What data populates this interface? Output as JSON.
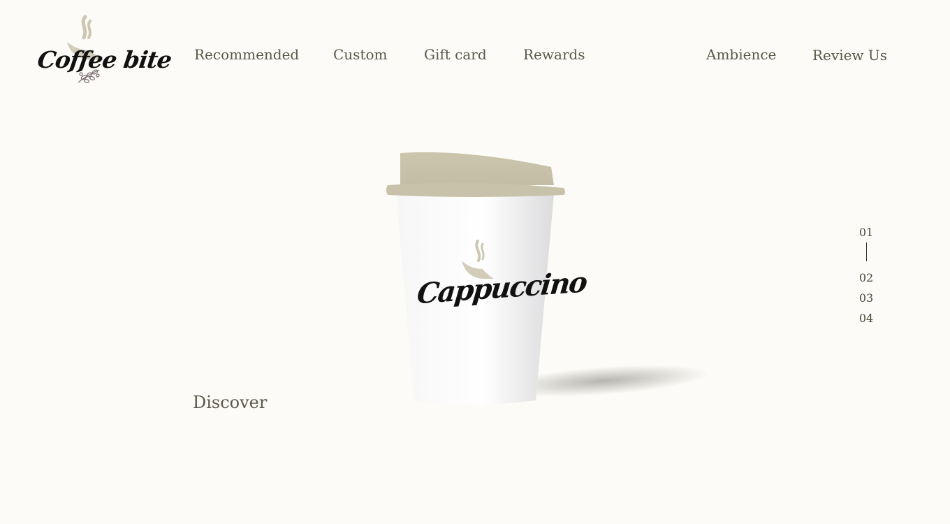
{
  "brand": {
    "logo_text": "Coffee bite",
    "logo_icon": "coffee-steam-icon"
  },
  "nav": {
    "left": [
      {
        "label": "Recommended"
      },
      {
        "label": "Custom"
      },
      {
        "label": "Gift card"
      },
      {
        "label": "Rewards"
      }
    ],
    "right": [
      {
        "label": "Ambience"
      },
      {
        "label": "Review Us"
      }
    ]
  },
  "hero": {
    "product_name": "Cappuccino",
    "cta_label": "Discover"
  },
  "pager": {
    "current": "01",
    "pages": [
      "01",
      "02",
      "03",
      "04"
    ]
  },
  "colors": {
    "background": "#fcfbf7",
    "text": "#5a5848",
    "accent_beige": "#ccc6b0",
    "logo_black": "#111111"
  }
}
